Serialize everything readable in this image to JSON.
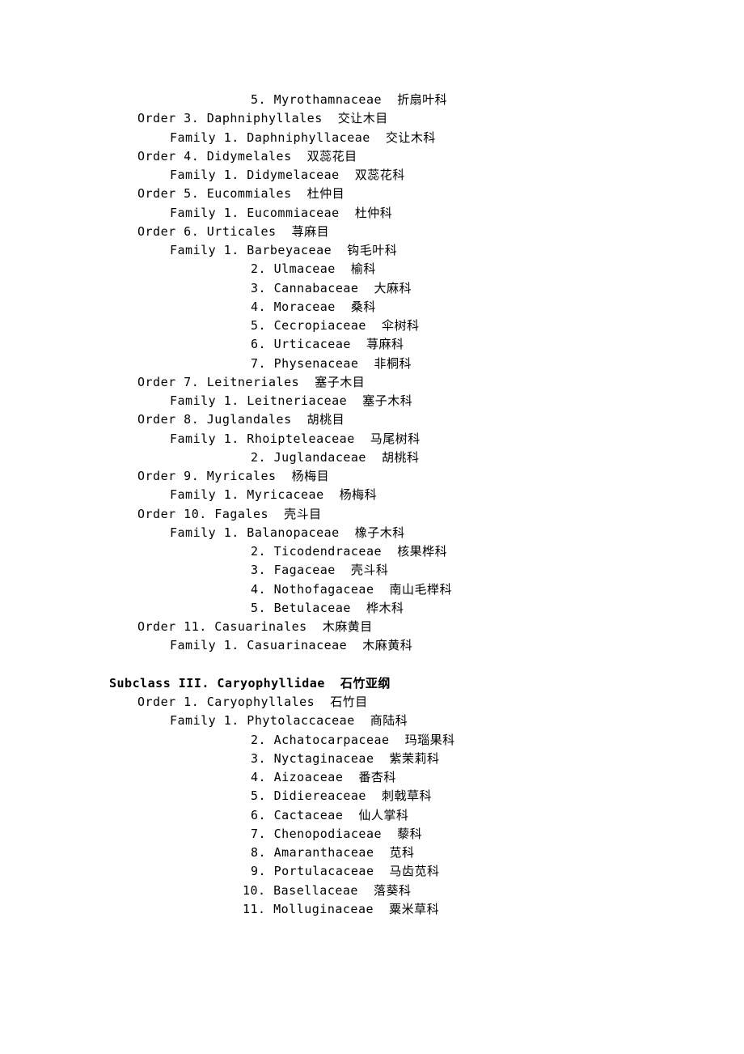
{
  "lines": [
    {
      "cls": "indent-num-2",
      "text": "5. Myrothamnaceae  折扇叶科"
    },
    {
      "cls": "indent-order",
      "text": "Order 3. Daphniphyllales  交让木目"
    },
    {
      "cls": "indent-family",
      "text": "Family 1. Daphniphyllaceae  交让木科"
    },
    {
      "cls": "indent-order",
      "text": "Order 4. Didymelales  双蕊花目"
    },
    {
      "cls": "indent-family",
      "text": "Family 1. Didymelaceae  双蕊花科"
    },
    {
      "cls": "indent-order",
      "text": "Order 5. Eucommiales  杜仲目"
    },
    {
      "cls": "indent-family",
      "text": "Family 1. Eucommiaceae  杜仲科"
    },
    {
      "cls": "indent-order",
      "text": "Order 6. Urticales  荨麻目"
    },
    {
      "cls": "indent-family",
      "text": "Family 1. Barbeyaceae  钩毛叶科"
    },
    {
      "cls": "indent-num-2",
      "text": "2. Ulmaceae  榆科"
    },
    {
      "cls": "indent-num-2",
      "text": "3. Cannabaceae  大麻科"
    },
    {
      "cls": "indent-num-2",
      "text": "4. Moraceae  桑科"
    },
    {
      "cls": "indent-num-2",
      "text": "5. Cecropiaceae  伞树科"
    },
    {
      "cls": "indent-num-2",
      "text": "6. Urticaceae  荨麻科"
    },
    {
      "cls": "indent-num-2",
      "text": "7. Physenaceae  非桐科"
    },
    {
      "cls": "indent-order",
      "text": "Order 7. Leitneriales  塞子木目"
    },
    {
      "cls": "indent-family",
      "text": "Family 1. Leitneriaceae  塞子木科"
    },
    {
      "cls": "indent-order",
      "text": "Order 8. Juglandales  胡桃目"
    },
    {
      "cls": "indent-family",
      "text": "Family 1. Rhoipteleaceae  马尾树科"
    },
    {
      "cls": "indent-num-2",
      "text": "2. Juglandaceae  胡桃科"
    },
    {
      "cls": "indent-order",
      "text": "Order 9. Myricales  杨梅目"
    },
    {
      "cls": "indent-family",
      "text": "Family 1. Myricaceae  杨梅科"
    },
    {
      "cls": "indent-order",
      "text": "Order 10. Fagales  壳斗目"
    },
    {
      "cls": "indent-family",
      "text": "Family 1. Balanopaceae  橡子木科"
    },
    {
      "cls": "indent-num-2",
      "text": "2. Ticodendraceae  核果桦科"
    },
    {
      "cls": "indent-num-2",
      "text": "3. Fagaceae  壳斗科"
    },
    {
      "cls": "indent-num-2",
      "text": "4. Nothofagaceae  南山毛榉科"
    },
    {
      "cls": "indent-num-2",
      "text": "5. Betulaceae  桦木科"
    },
    {
      "cls": "indent-order",
      "text": "Order 11. Casuarinales  木麻黄目"
    },
    {
      "cls": "indent-family",
      "text": "Family 1. Casuarinaceae  木麻黄科"
    },
    {
      "cls": "",
      "text": " "
    },
    {
      "cls": "indent-subclass subclass",
      "text": "Subclass III. Caryophyllidae  石竹亚纲"
    },
    {
      "cls": "indent-order",
      "text": "Order 1. Caryophyllales  石竹目"
    },
    {
      "cls": "indent-family",
      "text": "Family 1. Phytolaccaceae  商陆科"
    },
    {
      "cls": "indent-num-2",
      "text": "2. Achatocarpaceae  玛瑙果科"
    },
    {
      "cls": "indent-num-2",
      "text": "3. Nyctaginaceae  紫茉莉科"
    },
    {
      "cls": "indent-num-2",
      "text": "4. Aizoaceae  番杏科"
    },
    {
      "cls": "indent-num-2",
      "text": "5. Didiereaceae  刺戟草科"
    },
    {
      "cls": "indent-num-2",
      "text": "6. Cactaceae  仙人掌科"
    },
    {
      "cls": "indent-num-2",
      "text": "7. Chenopodiaceae  藜科"
    },
    {
      "cls": "indent-num-2",
      "text": "8. Amaranthaceae  苋科"
    },
    {
      "cls": "indent-num-2",
      "text": "9. Portulacaceae  马齿苋科"
    },
    {
      "cls": "indent-num-3",
      "text": "10. Basellaceae  落葵科"
    },
    {
      "cls": "indent-num-3",
      "text": "11. Molluginaceae  粟米草科"
    }
  ]
}
